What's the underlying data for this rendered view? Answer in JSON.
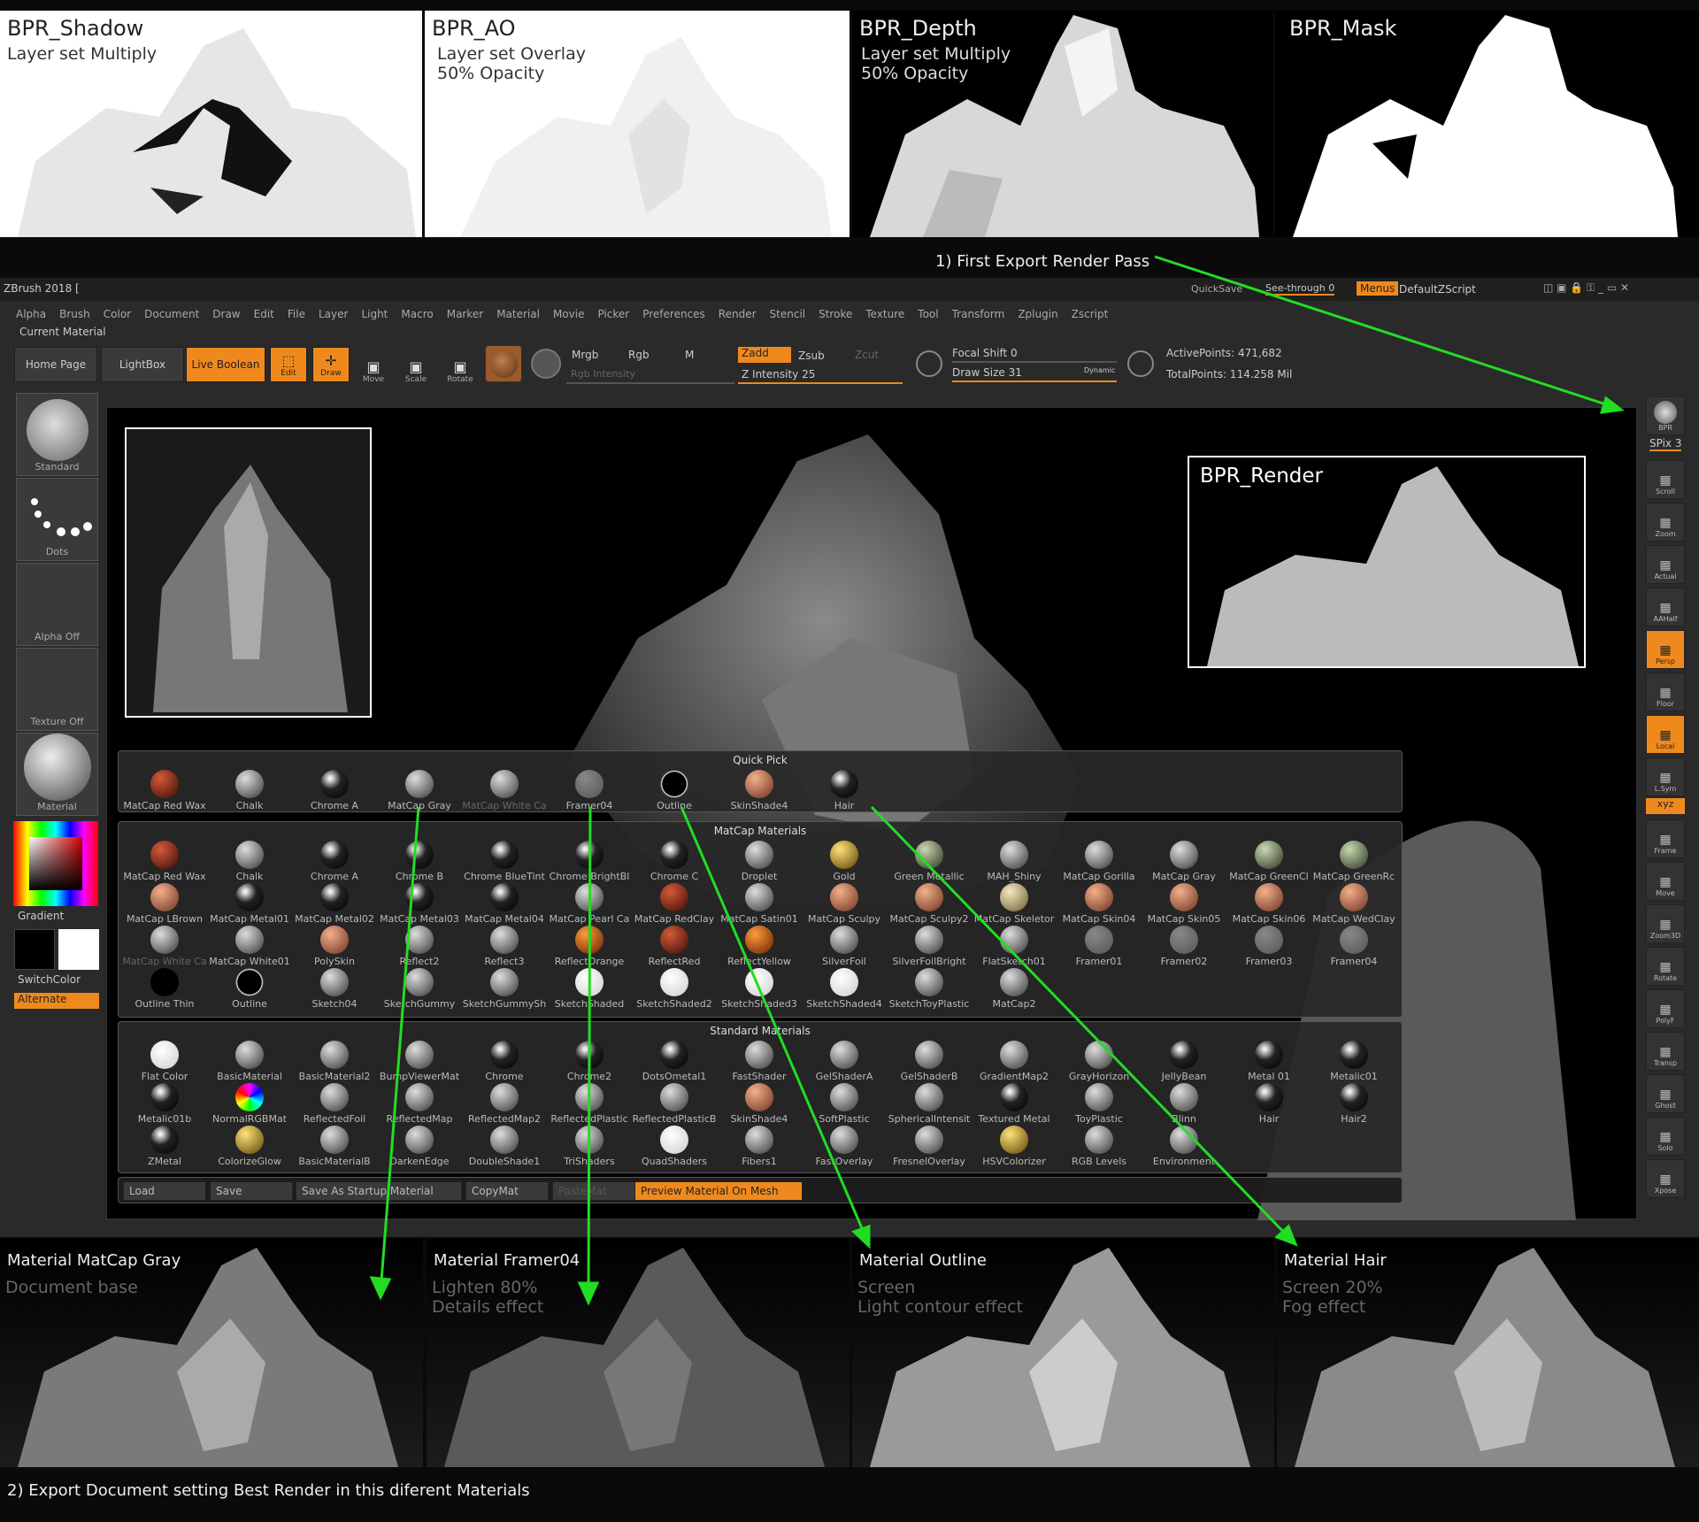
{
  "passes": [
    {
      "title": "BPR_Shadow",
      "sub": "Layer set Multiply"
    },
    {
      "title": "BPR_AO",
      "sub": "Layer set Overlay\n50% Opacity"
    },
    {
      "title": "BPR_Depth",
      "sub": "Layer set Multiply\n50% Opacity"
    },
    {
      "title": "BPR_Mask",
      "sub": ""
    }
  ],
  "step1": "1) First Export Render Pass",
  "step2": "2) Export Document setting Best Render in this diferent Materials",
  "titlebar": {
    "app": "ZBrush 2018 [",
    "quicksave": "QuickSave",
    "seethrough": "See-through",
    "seethrough_val": "0",
    "menus": "Menus",
    "script": "DefaultZScript"
  },
  "menu": [
    "Alpha",
    "Brush",
    "Color",
    "Document",
    "Draw",
    "Edit",
    "File",
    "Layer",
    "Light",
    "Macro",
    "Marker",
    "Material",
    "Movie",
    "Picker",
    "Preferences",
    "Render",
    "Stencil",
    "Stroke",
    "Texture",
    "Tool",
    "Transform",
    "Zplugin",
    "Zscript"
  ],
  "current_material": "Current Material",
  "toolbar": {
    "home": "Home Page",
    "lightbox": "LightBox",
    "liveboolean": "Live Boolean",
    "edit": "Edit",
    "draw": "Draw",
    "move": "Move",
    "scale": "Scale",
    "rotate": "Rotate",
    "mrgb": "Mrgb",
    "rgb": "Rgb",
    "m": "M",
    "zadd": "Zadd",
    "zsub": "Zsub",
    "zcut": "Zcut",
    "rgbint": "Rgb Intensity",
    "zint": "Z Intensity 25",
    "focal": "Focal Shift 0",
    "drawsize": "Draw Size 31",
    "dynamic": "Dynamic",
    "active": "ActivePoints: 471,682",
    "total": "TotalPoints: 114.258 Mil"
  },
  "left": {
    "standard": "Standard",
    "dots": "Dots",
    "alpha": "Alpha Off",
    "texture": "Texture Off",
    "material": "Material",
    "gradient": "Gradient",
    "switchcolor": "SwitchColor",
    "alternate": "Alternate"
  },
  "bpr_render": "BPR_Render",
  "right": {
    "bpr": "BPR",
    "spix": "SPix 3",
    "items": [
      {
        "l": "Scroll",
        "on": false
      },
      {
        "l": "Zoom",
        "on": false
      },
      {
        "l": "Actual",
        "on": false
      },
      {
        "l": "AAHalf",
        "on": false
      },
      {
        "l": "Persp",
        "on": true
      },
      {
        "l": "Floor",
        "on": false
      },
      {
        "l": "Local",
        "on": true
      },
      {
        "l": "L.Sym",
        "on": false
      },
      {
        "l": "Frame",
        "on": false
      },
      {
        "l": "Move",
        "on": false
      },
      {
        "l": "Zoom3D",
        "on": false
      },
      {
        "l": "Rotate",
        "on": false
      },
      {
        "l": "PolyF",
        "on": false
      },
      {
        "l": "Transp",
        "on": false
      },
      {
        "l": "Ghost",
        "on": false
      },
      {
        "l": "Solo",
        "on": false
      },
      {
        "l": "Xpose",
        "on": false
      }
    ],
    "xyz": "xyz"
  },
  "quickpick": {
    "header": "Quick Pick",
    "items": [
      "MatCap Red Wax",
      "Chalk",
      "Chrome A",
      "MatCap Gray",
      "MatCap White Ca",
      "Framer04",
      "Outline",
      "SkinShade4",
      "Hair"
    ]
  },
  "matcap": {
    "header": "MatCap Materials",
    "items": [
      "MatCap Red Wax",
      "Chalk",
      "Chrome A",
      "Chrome B",
      "Chrome BlueTint",
      "Chrome BrightBl",
      "Chrome C",
      "Droplet",
      "Gold",
      "Green Metallic",
      "MAH_Shiny",
      "MatCap Gorilla",
      "MatCap Gray",
      "MatCap GreenCl",
      "MatCap GreenRc",
      "MatCap LBrown",
      "MatCap Metal01",
      "MatCap Metal02",
      "MatCap Metal03",
      "MatCap Metal04",
      "MatCap Pearl Ca",
      "MatCap RedClay",
      "MatCap Satin01",
      "MatCap Sculpy",
      "MatCap Sculpy2",
      "MatCap Skeletor",
      "MatCap Skin04",
      "MatCap Skin05",
      "MatCap Skin06",
      "MatCap WedClay",
      "MatCap White Ca",
      "MatCap White01",
      "PolySkin",
      "Reflect2",
      "Reflect3",
      "ReflectOrange",
      "ReflectRed",
      "ReflectYellow",
      "SilverFoil",
      "SilverFoilBright",
      "FlatSketch01",
      "Framer01",
      "Framer02",
      "Framer03",
      "Framer04",
      "Outline Thin",
      "Outline",
      "Sketch04",
      "SketchGummy",
      "SketchGummySh",
      "SketchShaded",
      "SketchShaded2",
      "SketchShaded3",
      "SketchShaded4",
      "SketchToyPlastic",
      "MatCap2"
    ]
  },
  "standard": {
    "header": "Standard Materials",
    "items": [
      "Flat Color",
      "BasicMaterial",
      "BasicMaterial2",
      "BumpViewerMat",
      "Chrome",
      "Chrome2",
      "DotsOmetal1",
      "FastShader",
      "GelShaderA",
      "GelShaderB",
      "GradientMap2",
      "GrayHorizon",
      "JellyBean",
      "Metal 01",
      "Metalic01",
      "Metalic01b",
      "NormalRGBMat",
      "ReflectedFoil",
      "ReflectedMap",
      "ReflectedMap2",
      "ReflectedPlastic",
      "ReflectedPlasticB",
      "SkinShade4",
      "SoftPlastic",
      "SphericalIntensit",
      "Textured Metal",
      "ToyPlastic",
      "Blinn",
      "Hair",
      "Hair2",
      "ZMetal",
      "ColorizeGlow",
      "BasicMaterialB",
      "DarkenEdge",
      "DoubleShade1",
      "TriShaders",
      "QuadShaders",
      "Fibers1",
      "FastOverlay",
      "FresnelOverlay",
      "HSVColorizer",
      "RGB Levels",
      "Environment"
    ]
  },
  "buttons": {
    "load": "Load",
    "save": "Save",
    "startup": "Save As Startup Material",
    "copy": "CopyMat",
    "paste": "PasteMat",
    "preview": "Preview Material On Mesh"
  },
  "materials": [
    {
      "title": "Material MatCap Gray",
      "sub": "Document base"
    },
    {
      "title": "Material Framer04",
      "sub": "Lighten 80%\nDetails effect"
    },
    {
      "title": "Material Outline",
      "sub": "Screen\nLight contour effect"
    },
    {
      "title": "Material Hair",
      "sub": "Screen 20%\nFog effect"
    }
  ],
  "colors": {
    "accent": "#f0891d",
    "arrow": "#22dd22"
  }
}
